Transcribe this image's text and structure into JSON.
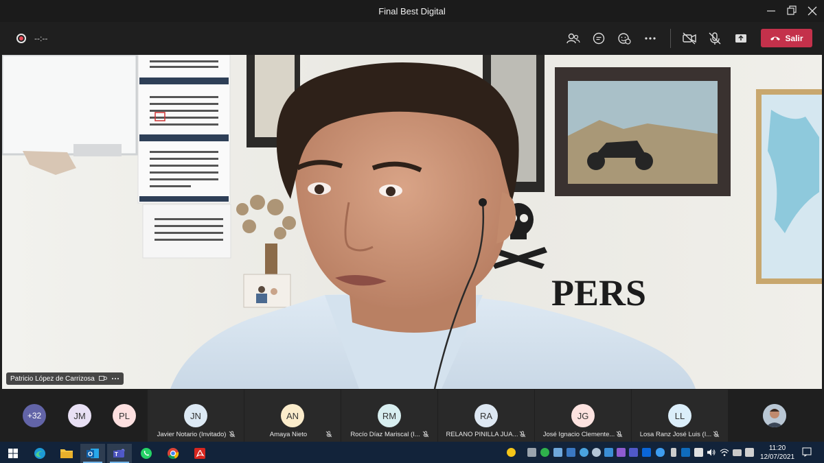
{
  "window": {
    "title": "Final Best Digital"
  },
  "toolbar": {
    "timer": "--:--",
    "leave_label": "Salir"
  },
  "main_video": {
    "participant_name": "Patricio López de Carrizosa"
  },
  "participants": {
    "overflow": "+32",
    "small": [
      {
        "initials": "JM",
        "color": "#e8e0f4"
      },
      {
        "initials": "PL",
        "color": "#fde0e0"
      }
    ],
    "tiles": [
      {
        "initials": "JN",
        "name": "Javier Notario (Invitado)",
        "color": "#dce9f4"
      },
      {
        "initials": "AN",
        "name": "Amaya Nieto",
        "color": "#fbeccb"
      },
      {
        "initials": "RM",
        "name": "Rocío Díaz Mariscal (I...",
        "color": "#d8eef0"
      },
      {
        "initials": "RA",
        "name": "RELANO PINILLA JUA...",
        "color": "#dde7f2"
      },
      {
        "initials": "JG",
        "name": "José Ignacio Clemente...",
        "color": "#fde3e0"
      },
      {
        "initials": "LL",
        "name": "Losa Ranz José Luis (I...",
        "color": "#dbeefa"
      }
    ]
  },
  "taskbar": {
    "time": "11:20",
    "date": "12/07/2021"
  }
}
